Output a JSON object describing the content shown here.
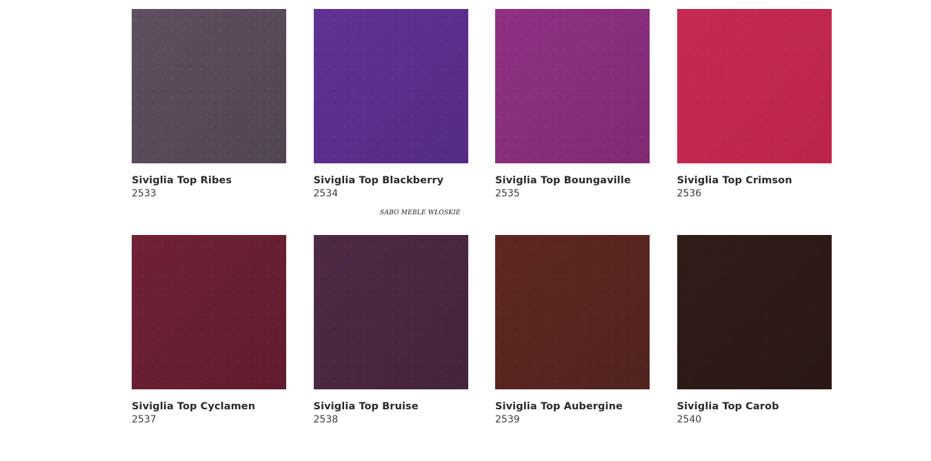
{
  "watermark": "SABO MEBLE WŁOSKIE",
  "swatches": [
    {
      "label": "Siviglia Top Ribes",
      "code": "2533",
      "color": "#5a4b5a"
    },
    {
      "label": "Siviglia Top Blackberry",
      "code": "2534",
      "color": "#5b2f8e"
    },
    {
      "label": "Siviglia Top Boungaville",
      "code": "2535",
      "color": "#8a2e7e"
    },
    {
      "label": "Siviglia Top Crimson",
      "code": "2536",
      "color": "#c2284e"
    },
    {
      "label": "Siviglia Top Cyclamen",
      "code": "2537",
      "color": "#6a1f33"
    },
    {
      "label": "Siviglia Top Bruise",
      "code": "2538",
      "color": "#4a2840"
    },
    {
      "label": "Siviglia Top Aubergine",
      "code": "2539",
      "color": "#5a2620"
    },
    {
      "label": "Siviglia Top Carob",
      "code": "2540",
      "color": "#2e1a17"
    }
  ]
}
